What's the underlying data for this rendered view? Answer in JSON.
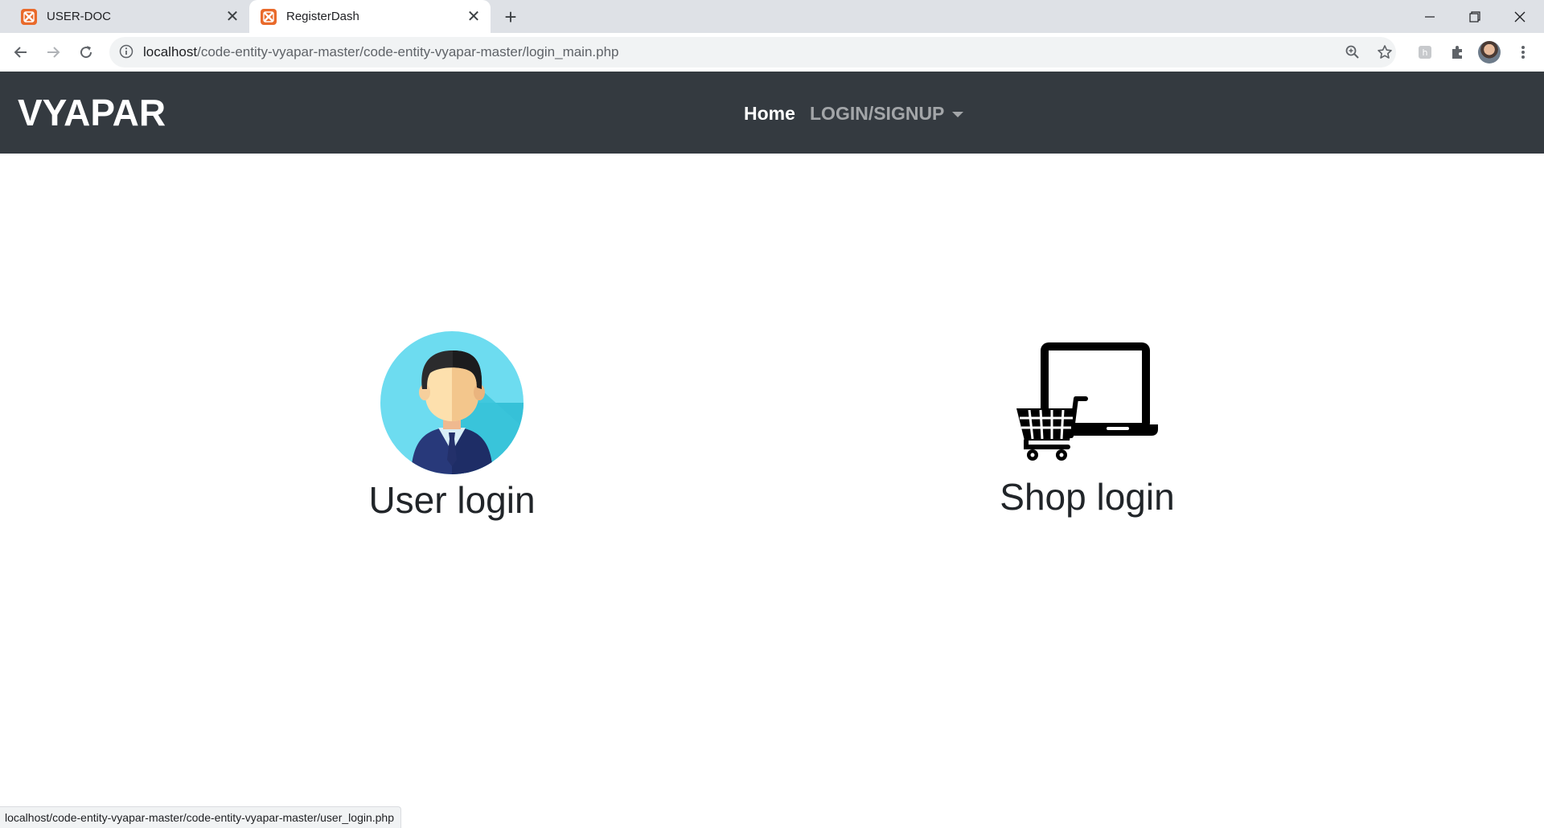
{
  "browser": {
    "tabs": [
      {
        "title": "USER-DOC",
        "active": false
      },
      {
        "title": "RegisterDash",
        "active": true
      }
    ],
    "new_tab": "+",
    "url_host": "localhost",
    "url_path": "/code-entity-vyapar-master/code-entity-vyapar-master/login_main.php",
    "status_url": "localhost/code-entity-vyapar-master/code-entity-vyapar-master/user_login.php"
  },
  "navbar": {
    "brand": "VYAPAR",
    "home": "Home",
    "login_signup": "LOGIN/SIGNUP",
    "bg_color": "#343a40"
  },
  "cards": {
    "user": {
      "title": "User login",
      "icon": "businessman-avatar-icon"
    },
    "shop": {
      "title": "Shop login",
      "icon": "laptop-shopping-cart-icon"
    }
  }
}
